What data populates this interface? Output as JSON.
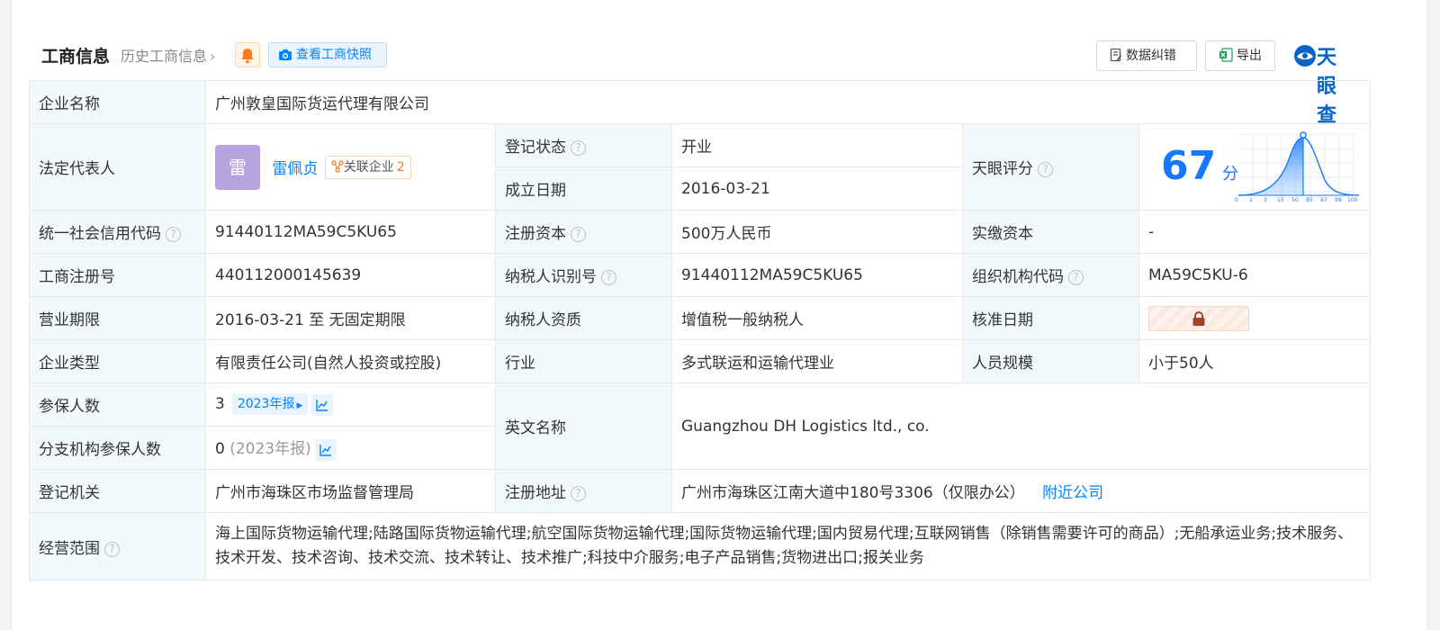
{
  "header": {
    "title": "工商信息",
    "history_link": "历史工商信息",
    "snapshot_button": "查看工商快照",
    "correction_button": "数据纠错",
    "export_button": "导出",
    "brand": "天眼查"
  },
  "company": {
    "name_label": "企业名称",
    "name_value": "广州敦皇国际货运代理有限公司",
    "legal_rep_label": "法定代表人",
    "legal_rep_avatar": "雷",
    "legal_rep_name": "雷佩贞",
    "related_label": "关联企业",
    "related_count": "2",
    "reg_status_label": "登记状态",
    "reg_status_value": "开业",
    "found_date_label": "成立日期",
    "found_date_value": "2016-03-21",
    "score_label": "天眼评分",
    "score_value": "67",
    "score_unit": "分",
    "score_axis": [
      "0",
      "1",
      "3",
      "15",
      "50",
      "85",
      "97",
      "99",
      "100"
    ],
    "credit_code_label": "统一社会信用代码",
    "credit_code_value": "91440112MA59C5KU65",
    "capital_label": "注册资本",
    "capital_value": "500万人民币",
    "paid_capital_label": "实缴资本",
    "paid_capital_value": "-",
    "biz_reg_no_label": "工商注册号",
    "biz_reg_no_value": "440112000145639",
    "taxpayer_id_label": "纳税人识别号",
    "taxpayer_id_value": "91440112MA59C5KU65",
    "org_code_label": "组织机构代码",
    "org_code_value": "MA59C5KU-6",
    "term_label": "营业期限",
    "term_value": "2016-03-21 至 无固定期限",
    "taxpayer_qual_label": "纳税人资质",
    "taxpayer_qual_value": "增值税一般纳税人",
    "approval_date_label": "核准日期",
    "type_label": "企业类型",
    "type_value": "有限责任公司(自然人投资或控股)",
    "industry_label": "行业",
    "industry_value": "多式联运和运输代理业",
    "staff_label": "人员规模",
    "staff_value": "小于50人",
    "insured_label": "参保人数",
    "insured_value": "3",
    "insured_year_tag": "2023年报",
    "english_name_label": "英文名称",
    "english_name_value": "Guangzhou DH Logistics ltd., co.",
    "branch_insured_label": "分支机构参保人数",
    "branch_insured_value": "0",
    "branch_insured_year": "(2023年报)",
    "authority_label": "登记机关",
    "authority_value": "广州市海珠区市场监督管理局",
    "address_label": "注册地址",
    "address_value": "广州市海珠区江南大道中180号3306（仅限办公）",
    "nearby_link": "附近公司",
    "scope_label": "经营范围",
    "scope_value": "海上国际货物运输代理;陆路国际货物运输代理;航空国际货物运输代理;国际货物运输代理;国内贸易代理;互联网销售（除销售需要许可的商品）;无船承运业务;技术服务、技术开发、技术咨询、技术交流、技术转让、技术推广;科技中介服务;电子产品销售;货物进出口;报关业务"
  },
  "colors": {
    "accent": "#0084ff",
    "status_green": "#009944",
    "label_bg": "#f2f9fc"
  }
}
